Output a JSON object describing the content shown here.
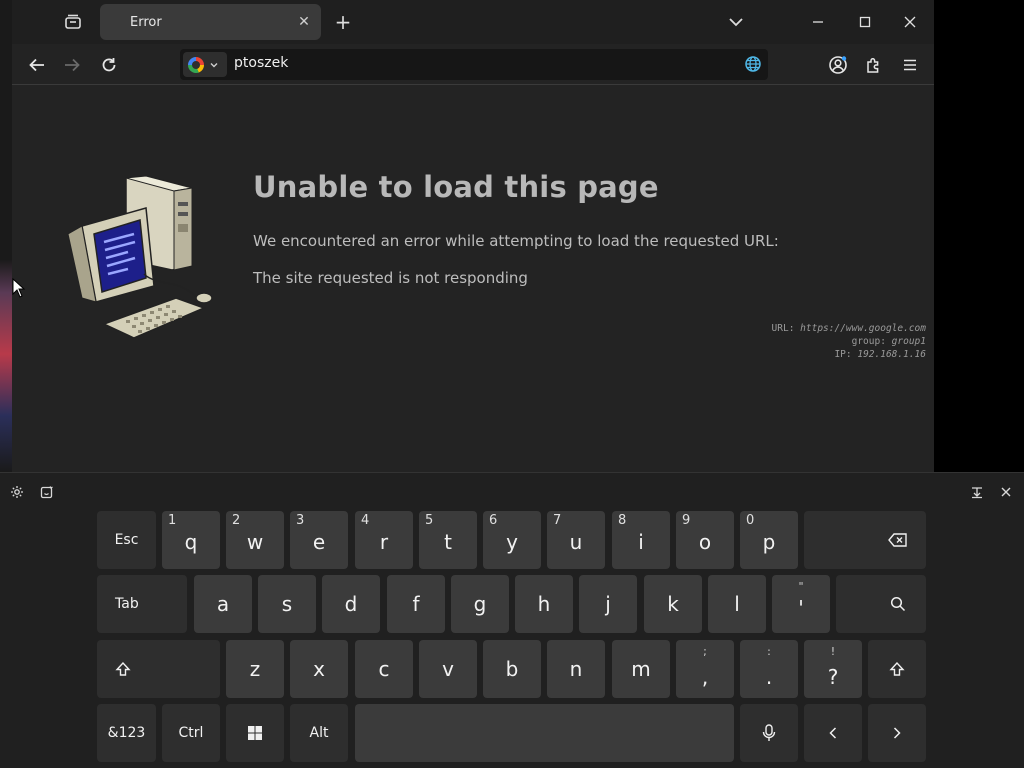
{
  "browser": {
    "tab": {
      "title": "Error"
    },
    "address_bar": {
      "value": "ptoszek"
    }
  },
  "error_page": {
    "title": "Unable to load this page",
    "line1": "We encountered an error while attempting to load the requested URL:",
    "line2": "The site requested is not responding",
    "meta": {
      "url_label": "URL:",
      "url_value": "https://www.google.com",
      "group_label": "group:",
      "group_value": "group1",
      "ip_label": "IP:",
      "ip_value": "192.168.1.16"
    }
  },
  "keyboard": {
    "row1": [
      {
        "label": "Esc",
        "sub": ""
      },
      {
        "label": "q",
        "sub": "1"
      },
      {
        "label": "w",
        "sub": "2"
      },
      {
        "label": "e",
        "sub": "3"
      },
      {
        "label": "r",
        "sub": "4"
      },
      {
        "label": "t",
        "sub": "5"
      },
      {
        "label": "y",
        "sub": "6"
      },
      {
        "label": "u",
        "sub": "7"
      },
      {
        "label": "i",
        "sub": "8"
      },
      {
        "label": "o",
        "sub": "9"
      },
      {
        "label": "p",
        "sub": "0"
      }
    ],
    "row2": [
      {
        "label": "Tab"
      },
      {
        "label": "a"
      },
      {
        "label": "s"
      },
      {
        "label": "d"
      },
      {
        "label": "f"
      },
      {
        "label": "g"
      },
      {
        "label": "h"
      },
      {
        "label": "j"
      },
      {
        "label": "k"
      },
      {
        "label": "l"
      },
      {
        "label": "'",
        "top": "\""
      }
    ],
    "row3": [
      {
        "label": "z"
      },
      {
        "label": "x"
      },
      {
        "label": "c"
      },
      {
        "label": "v"
      },
      {
        "label": "b"
      },
      {
        "label": "n"
      },
      {
        "label": "m"
      },
      {
        "label": ",",
        "top": ";"
      },
      {
        "label": ".",
        "top": ":"
      },
      {
        "label": "?",
        "top": "!"
      }
    ],
    "row4": {
      "symbols": "&123",
      "ctrl": "Ctrl",
      "alt": "Alt"
    }
  },
  "colors": {
    "page_bg": "#232323",
    "title": "#b8b8b8",
    "key_bg": "#3b3b3b",
    "key_fn_bg": "#2e2e2e"
  }
}
